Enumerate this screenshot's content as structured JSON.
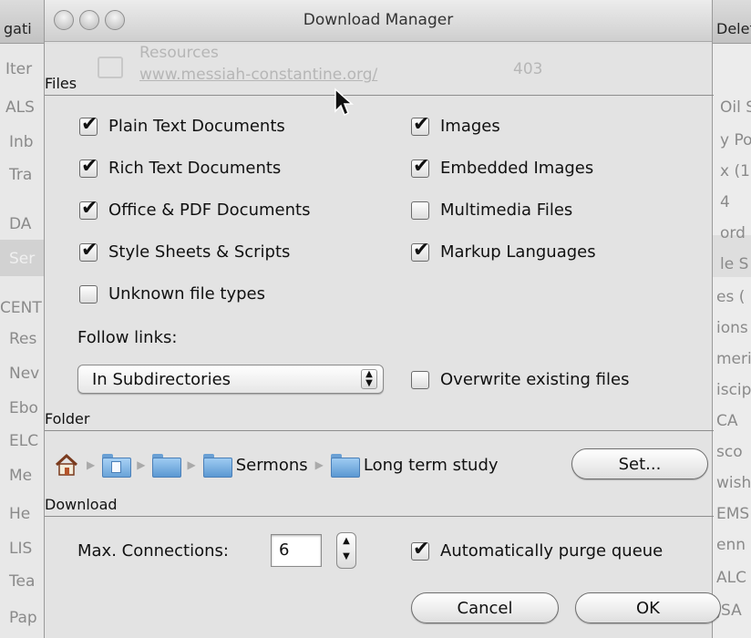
{
  "background": {
    "left_title": "gati",
    "right_title": "Delet",
    "left_items": [
      "Iter",
      "ALS",
      "Inb",
      "Tra",
      "DA",
      "Ser",
      "CENT",
      "Res",
      "Nev",
      "Ebo",
      "ELC",
      "Me",
      "He",
      "LIS",
      "Tea",
      "Pap"
    ],
    "right_items": [
      "Oil S",
      "y Po",
      "x (1",
      "4",
      "ord",
      "le S",
      "es (",
      "ions",
      "meri",
      "iscip",
      "CA",
      "sco",
      "wish",
      "EMS",
      "enn",
      "ALC",
      "JSA"
    ]
  },
  "window": {
    "title": "Download Manager"
  },
  "ghost_row": {
    "name": "Resources",
    "url": "www.messiah-constantine.org/",
    "count": "403"
  },
  "files": {
    "section_label": "Files",
    "checkboxes": [
      {
        "label": "Plain Text Documents",
        "checked": true
      },
      {
        "label": "Images",
        "checked": true
      },
      {
        "label": "Rich Text Documents",
        "checked": true
      },
      {
        "label": "Embedded Images",
        "checked": true
      },
      {
        "label": "Office & PDF Documents",
        "checked": true
      },
      {
        "label": "Multimedia Files",
        "checked": false
      },
      {
        "label": "Style Sheets & Scripts",
        "checked": true
      },
      {
        "label": "Markup Languages",
        "checked": true
      },
      {
        "label": "Unknown file types",
        "checked": false
      }
    ],
    "follow_links_label": "Follow links:",
    "follow_links_value": "In Subdirectories",
    "overwrite_label": "Overwrite existing files",
    "overwrite_checked": false
  },
  "folder": {
    "section_label": "Folder",
    "path": [
      "Sermons",
      "Long term study"
    ],
    "set_button": "Set..."
  },
  "download": {
    "section_label": "Download",
    "max_connections_label": "Max. Connections:",
    "max_connections_value": "6",
    "auto_purge_label": "Automatically purge queue",
    "auto_purge_checked": true
  },
  "buttons": {
    "cancel": "Cancel",
    "ok": "OK"
  }
}
